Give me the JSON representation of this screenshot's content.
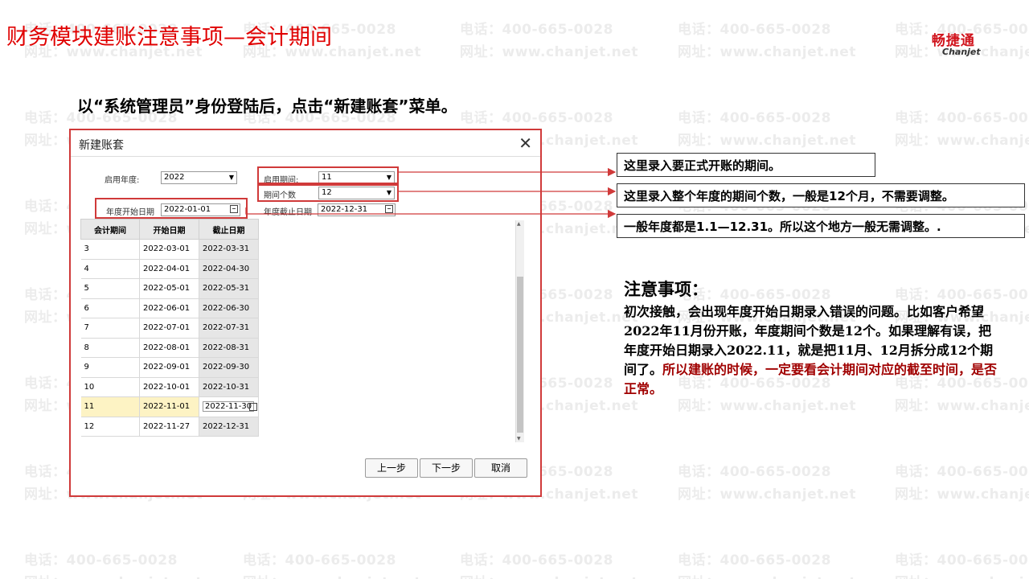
{
  "watermark": {
    "phone": "电话：400-665-0028",
    "site": "网址：www.chanjet.net"
  },
  "slide": {
    "title": "财务模块建账注意事项—会计期间",
    "logo_cn": "畅捷通",
    "logo_en": "Chanjet",
    "instruction": "以“系统管理员”身份登陆后，点击“新建账套”菜单。"
  },
  "dialog": {
    "title": "新建账套",
    "close": "✕",
    "start_year_label": "启用年度:",
    "start_year_value": "2022",
    "start_period_label": "启用期间:",
    "start_period_value": "11",
    "period_count_label": "期间个数",
    "period_count_value": "12",
    "year_start_label": "年度开始日期",
    "year_start_value": "2022-01-01",
    "year_end_label": "年度截止日期",
    "year_end_value": "2022-12-31",
    "columns": [
      "会计期间",
      "开始日期",
      "截止日期"
    ],
    "rows": [
      [
        "3",
        "2022-03-01",
        "2022-03-31"
      ],
      [
        "4",
        "2022-04-01",
        "2022-04-30"
      ],
      [
        "5",
        "2022-05-01",
        "2022-05-31"
      ],
      [
        "6",
        "2022-06-01",
        "2022-06-30"
      ],
      [
        "7",
        "2022-07-01",
        "2022-07-31"
      ],
      [
        "8",
        "2022-08-01",
        "2022-08-31"
      ],
      [
        "9",
        "2022-09-01",
        "2022-09-30"
      ],
      [
        "10",
        "2022-10-01",
        "2022-10-31"
      ],
      [
        "11",
        "2022-11-01",
        "2022-11-30"
      ],
      [
        "12",
        "2022-11-27",
        "2022-12-31"
      ]
    ],
    "selected_row": 8,
    "buttons": {
      "prev": "上一步",
      "next": "下一步",
      "cancel": "取消"
    }
  },
  "callouts": [
    "这里录入要正式开账的期间。",
    "这里录入整个年度的期间个数，一般是12个月，不需要调整。",
    "一般年度都是1.1—12.31。所以这个地方一般无需调整。."
  ],
  "notes": {
    "title": "注意事项：",
    "body_black": "初次接触，会出现年度开始日期录入错误的问题。比如客户希望2022年11月份开账，年度期间个数是12个。如果理解有误，把年度开始日期录入2022.11，就是把11月、12月拆分成12个期间了。",
    "body_red": "所以建账的时候，一定要看会计期间对应的截至时间，是否正常。"
  },
  "colors": {
    "accent_red": "#e00000",
    "box_red": "#d03a3a",
    "selected_row": "#fdf3c4",
    "note_red": "#a00000"
  }
}
